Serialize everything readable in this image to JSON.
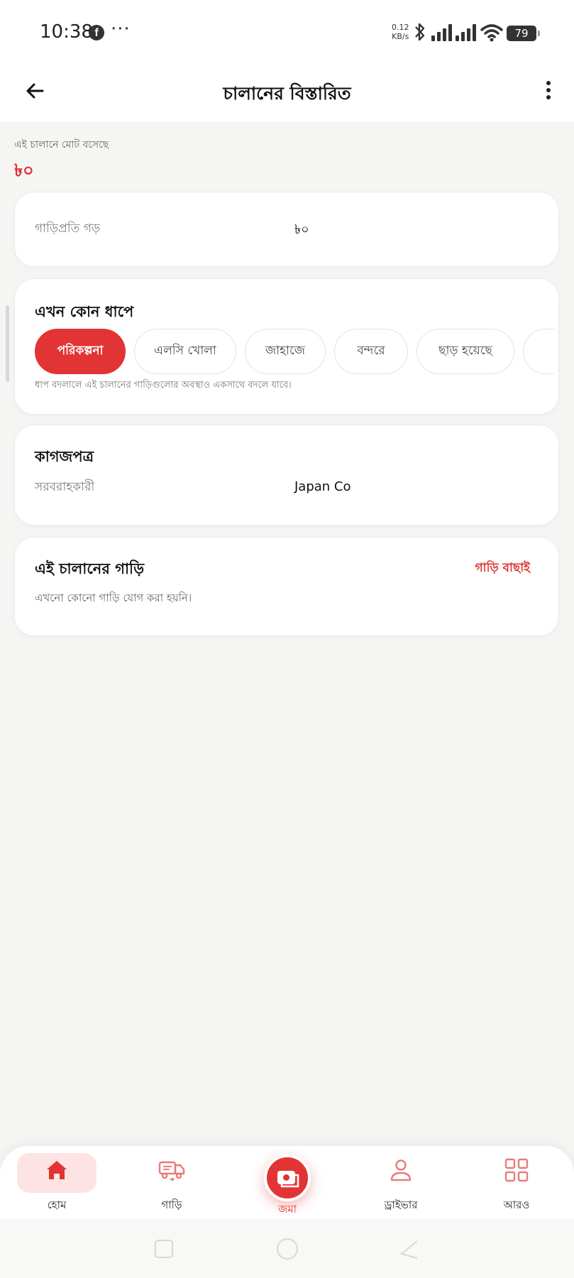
{
  "status_bar": {
    "time": "10:38",
    "net_speed_value": "0.12",
    "net_speed_unit": "KB/s",
    "battery": "79"
  },
  "app_bar": {
    "title": "চালানের বিস্তারিত"
  },
  "summary": {
    "label": "এই চালানে মোট বসেছে",
    "value": "৳০"
  },
  "avg_card": {
    "label": "গাড়িপ্রতি গড়",
    "value": "৳০"
  },
  "stage_card": {
    "title": "এখন কোন ধাপে",
    "stages": [
      "পরিকল্পনা",
      "এলসি খোলা",
      "জাহাজে",
      "বন্দরে",
      "ছাড় হয়েছে"
    ],
    "active_stage": "পরিকল্পনা",
    "hint": "ধাপ বদলালে এই চালানের গাড়িগুলোর অবস্থাও একসাথে বদলে যাবে।"
  },
  "docs_card": {
    "title": "কাগজপত্র",
    "supplier_label": "সরবরাহকারী",
    "supplier_value": "Japan Co"
  },
  "cars_card": {
    "title": "এই চালানের গাড়ি",
    "select_link": "গাড়ি বাছাই",
    "empty_text": "এখনো কোনো গাড়ি যোগ করা হয়নি।"
  },
  "bottom_nav": {
    "items": [
      {
        "label": "হোম",
        "icon": "home-icon",
        "active": true
      },
      {
        "label": "গাড়ি",
        "icon": "truck-icon"
      },
      {
        "label": "জমা",
        "icon": "camera-icon"
      },
      {
        "label": "ড্রাইভার",
        "icon": "person-icon"
      },
      {
        "label": "আরও",
        "icon": "grid-icon"
      }
    ]
  },
  "colors": {
    "accent": "#e23434",
    "accent_light": "#fde3e3",
    "background": "#f5f5f3"
  }
}
